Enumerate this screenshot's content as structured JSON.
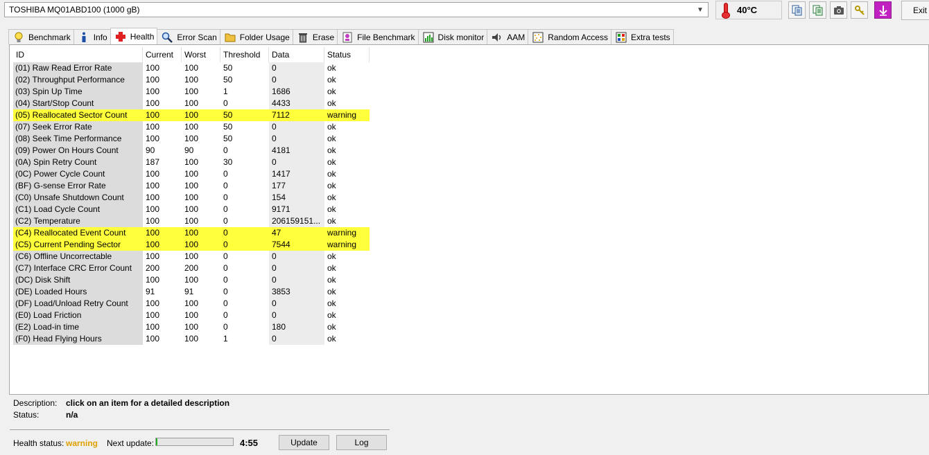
{
  "drive": {
    "selected": "TOSHIBA MQ01ABD100 (1000 gB)"
  },
  "temperature": {
    "value": "40°C"
  },
  "toolbar": {
    "icons": [
      "copy-icon",
      "copy-icon",
      "camera-icon",
      "keys-icon",
      "download-icon"
    ],
    "exit_label": "Exit"
  },
  "tabs": [
    {
      "label": "Benchmark",
      "icon": "lightbulb-icon"
    },
    {
      "label": "Info",
      "icon": "info-icon"
    },
    {
      "label": "Health",
      "icon": "health-cross-icon",
      "active": true
    },
    {
      "label": "Error Scan",
      "icon": "magnifier-icon"
    },
    {
      "label": "Folder Usage",
      "icon": "folder-icon"
    },
    {
      "label": "Erase",
      "icon": "trash-icon"
    },
    {
      "label": "File Benchmark",
      "icon": "file-benchmark-icon"
    },
    {
      "label": "Disk monitor",
      "icon": "bar-chart-icon"
    },
    {
      "label": "AAM",
      "icon": "speaker-icon"
    },
    {
      "label": "Random Access",
      "icon": "random-access-icon"
    },
    {
      "label": "Extra tests",
      "icon": "extra-tests-icon"
    }
  ],
  "table": {
    "headers": [
      "ID",
      "Current",
      "Worst",
      "Threshold",
      "Data",
      "Status"
    ],
    "rows": [
      [
        "(01) Raw Read Error Rate",
        "100",
        "100",
        "50",
        "0",
        "ok"
      ],
      [
        "(02) Throughput Performance",
        "100",
        "100",
        "50",
        "0",
        "ok"
      ],
      [
        "(03) Spin Up Time",
        "100",
        "100",
        "1",
        "1686",
        "ok"
      ],
      [
        "(04) Start/Stop Count",
        "100",
        "100",
        "0",
        "4433",
        "ok"
      ],
      [
        "(05) Reallocated Sector Count",
        "100",
        "100",
        "50",
        "7112",
        "warning"
      ],
      [
        "(07) Seek Error Rate",
        "100",
        "100",
        "50",
        "0",
        "ok"
      ],
      [
        "(08) Seek Time Performance",
        "100",
        "100",
        "50",
        "0",
        "ok"
      ],
      [
        "(09) Power On Hours Count",
        "90",
        "90",
        "0",
        "4181",
        "ok"
      ],
      [
        "(0A) Spin Retry Count",
        "187",
        "100",
        "30",
        "0",
        "ok"
      ],
      [
        "(0C) Power Cycle Count",
        "100",
        "100",
        "0",
        "1417",
        "ok"
      ],
      [
        "(BF) G-sense Error Rate",
        "100",
        "100",
        "0",
        "177",
        "ok"
      ],
      [
        "(C0) Unsafe Shutdown Count",
        "100",
        "100",
        "0",
        "154",
        "ok"
      ],
      [
        "(C1) Load Cycle Count",
        "100",
        "100",
        "0",
        "9171",
        "ok"
      ],
      [
        "(C2) Temperature",
        "100",
        "100",
        "0",
        "206159151...",
        "ok"
      ],
      [
        "(C4) Reallocated Event Count",
        "100",
        "100",
        "0",
        "47",
        "warning"
      ],
      [
        "(C5) Current Pending Sector",
        "100",
        "100",
        "0",
        "7544",
        "warning"
      ],
      [
        "(C6) Offline Uncorrectable",
        "100",
        "100",
        "0",
        "0",
        "ok"
      ],
      [
        "(C7) Interface CRC Error Count",
        "200",
        "200",
        "0",
        "0",
        "ok"
      ],
      [
        "(DC) Disk Shift",
        "100",
        "100",
        "0",
        "0",
        "ok"
      ],
      [
        "(DE) Loaded Hours",
        "91",
        "91",
        "0",
        "3853",
        "ok"
      ],
      [
        "(DF) Load/Unload Retry Count",
        "100",
        "100",
        "0",
        "0",
        "ok"
      ],
      [
        "(E0) Load Friction",
        "100",
        "100",
        "0",
        "0",
        "ok"
      ],
      [
        "(E2) Load-in time",
        "100",
        "100",
        "0",
        "180",
        "ok"
      ],
      [
        "(F0) Head Flying Hours",
        "100",
        "100",
        "1",
        "0",
        "ok"
      ]
    ]
  },
  "description": {
    "label": "Description:",
    "value": "click on an item for a detailed description",
    "status_label": "Status:",
    "status_value": "n/a"
  },
  "footer": {
    "health_label": "Health status:",
    "health_value": "warning",
    "next_update_label": "Next update:",
    "progress_fraction": 0.02,
    "time": "4:55",
    "update_label": "Update",
    "log_label": "Log"
  },
  "colors": {
    "warning_row": "#ffff3c",
    "warning_text": "#e0a000",
    "progress": "#20b020"
  }
}
